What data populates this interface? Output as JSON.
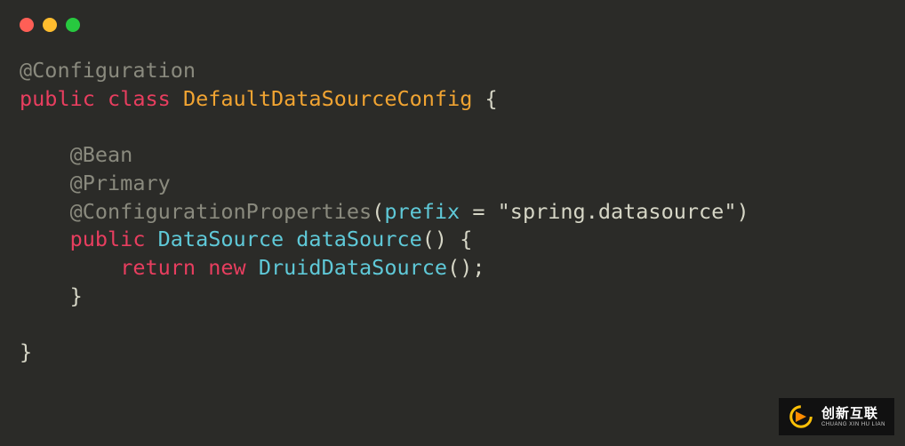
{
  "traffic_lights": {
    "red": "#ff5f56",
    "yellow": "#ffbd2e",
    "green": "#27c93f"
  },
  "code": {
    "line1": {
      "annotation": "@Configuration"
    },
    "line2": {
      "kw_public": "public",
      "kw_class": "class",
      "classname": "DefaultDataSourceConfig",
      "brace_open": " {"
    },
    "line3": "",
    "line4": {
      "indent": "    ",
      "annotation": "@Bean"
    },
    "line5": {
      "indent": "    ",
      "annotation": "@Primary"
    },
    "line6": {
      "indent": "    ",
      "annotation": "@ConfigurationProperties",
      "paren_open": "(",
      "param": "prefix",
      "eq": " = ",
      "string": "\"spring.datasource\"",
      "paren_close": ")"
    },
    "line7": {
      "indent": "    ",
      "kw_public": "public",
      "ret_type": "DataSource",
      "method": "dataSource",
      "parens": "()",
      "brace_open": " {"
    },
    "line8": {
      "indent": "        ",
      "kw_return": "return",
      "kw_new": "new",
      "ctor": "DruidDataSource",
      "tail": "();"
    },
    "line9": {
      "indent": "    ",
      "brace_close": "}"
    },
    "line10": "",
    "line11": {
      "brace_close": "}"
    }
  },
  "badge": {
    "cn": "创新互联",
    "en": "CHUANG XIN HU LIAN"
  }
}
